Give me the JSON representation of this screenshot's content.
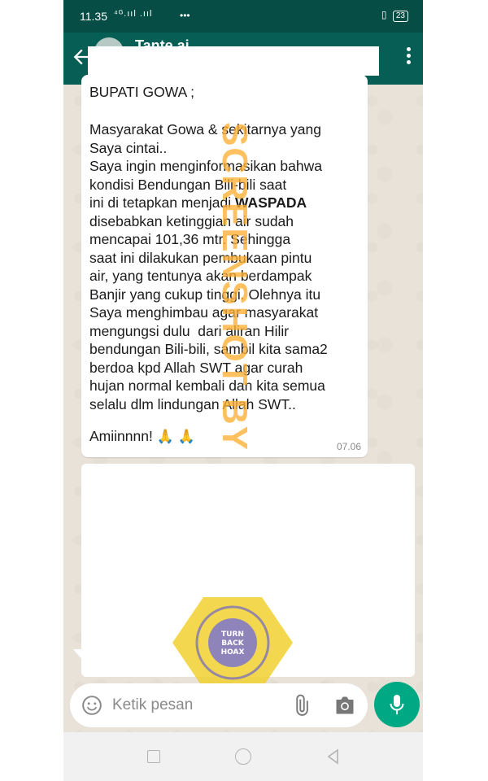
{
  "status_bar": {
    "time": "11.35",
    "network": "⁴ᴳ.ııl .ııl",
    "dots": "•••",
    "battery": "23"
  },
  "app_bar": {
    "contact_name": "Tante ai"
  },
  "message": {
    "header": "BUPATI GOWA ;",
    "body_lines": [
      "Masyarakat Gowa & sekitarnya yang",
      "Saya cintai..",
      "Saya ingin menginformasikan bahwa",
      "kondisi Bendungan Bili-bili saat",
      "ini di tetapkan menjadi ",
      "disebabkan ketinggian air sudah",
      "mencapai 101,36 mtr. Sehingga",
      "saat ini dilakukan pembukaan pintu",
      "air, yang tentunya akan berdampak",
      "Banjir yang cukup tinggi. Olehnya itu",
      "Saya menghimbau agar masyarakat",
      "mengungsi dulu  dari aliran Hilir",
      "bendungan Bili-bili, sambil kita sama2",
      "berdoa kpd Allah SWT agar curah",
      "hujan normal kembali dan kita semua",
      "selalu dlm lindungan Allah SWT.."
    ],
    "bold_word": "WASPADA",
    "closing": "Amiinnnn! ",
    "emoji": "🙏 🙏",
    "time": "07.06"
  },
  "watermark": {
    "text": "SCREENSHOT BY"
  },
  "logo": {
    "ring_text_top": "MASYARAKAT ANTI FITNAH INDONESIA",
    "ring_text_bottom": "MAFINDO",
    "center_text": "TURN BACK HOAX"
  },
  "composer": {
    "placeholder": "Ketik pesan"
  },
  "colors": {
    "header": "#075e54",
    "status": "#064e45",
    "accent": "#00a884",
    "watermark": "#ffb032"
  }
}
